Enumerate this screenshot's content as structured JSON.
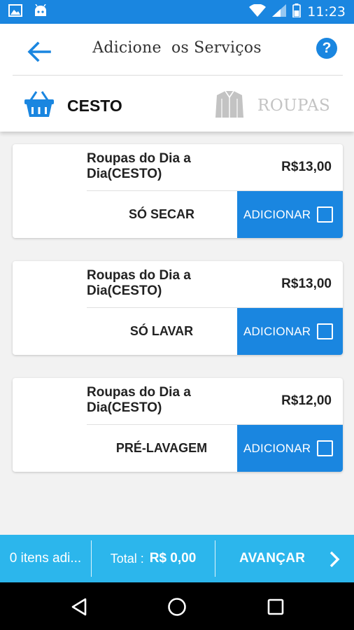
{
  "status_bar": {
    "time": "11:23",
    "icons": [
      "image-icon",
      "android-icon",
      "wifi-icon",
      "signal-icon",
      "battery-icon"
    ]
  },
  "header": {
    "title": "Adicione  os Serviços",
    "back_icon": "arrow-left-icon",
    "help_label": "?"
  },
  "tabs": [
    {
      "label": "CESTO",
      "icon": "basket-icon",
      "active": true
    },
    {
      "label": "ROUPAS",
      "icon": "shirt-icon",
      "active": false
    }
  ],
  "services": [
    {
      "name": "Roupas do Dia a Dia(CESTO)",
      "price": "R$13,00",
      "type": "SÓ SECAR",
      "action": "ADICIONAR",
      "checked": false
    },
    {
      "name": "Roupas do Dia a Dia(CESTO)",
      "price": "R$13,00",
      "type": "SÓ LAVAR",
      "action": "ADICIONAR",
      "checked": false
    },
    {
      "name": "Roupas do Dia a Dia(CESTO)",
      "price": "R$12,00",
      "type": "PRÉ-LAVAGEM",
      "action": "ADICIONAR",
      "checked": false
    }
  ],
  "footer": {
    "items_added": "0 itens adi...",
    "total_label": "Total :",
    "total_value": "R$ 0,00",
    "advance_label": "AVANÇAR"
  },
  "colors": {
    "primary": "#1a86e0",
    "footer": "#2cb6ec",
    "inactive_tab": "#c3c3c3"
  }
}
